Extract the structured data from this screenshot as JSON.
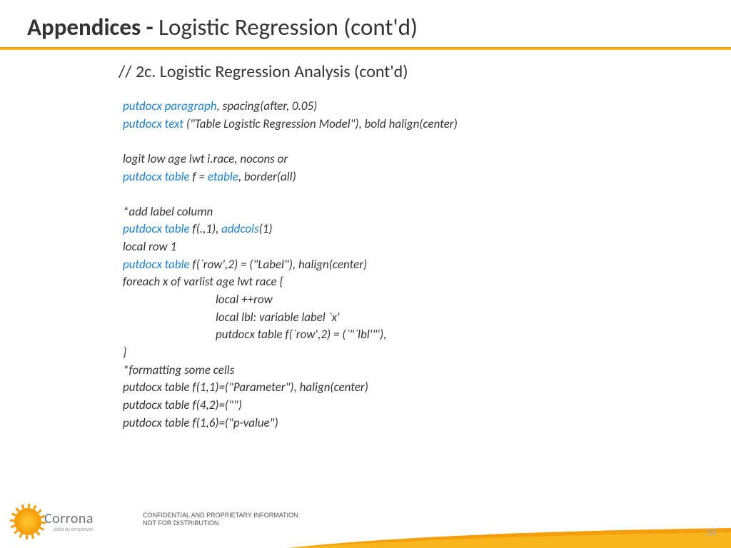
{
  "title": {
    "bold": "Appendices - ",
    "rest": "Logistic Regression (cont'd)"
  },
  "section_header": "// 2c. Logistic Regression Analysis (cont'd)",
  "code": {
    "l1_kw": "putdocx paragraph",
    "l1_rest": ", spacing(after, 0.05)",
    "l2_kw": "putdocx text ",
    "l2_rest": "(\"Table Logistic Regression Model\"), bold halign(center)",
    "l3": "logit low age lwt i.race, nocons or",
    "l4_kw1": "putdocx table ",
    "l4_mid": "f = ",
    "l4_kw2": "etable",
    "l4_rest": ", border(all)",
    "l5": "*add label column",
    "l6_kw1": "putdocx table ",
    "l6_mid": "f(.,1), ",
    "l6_kw2": "addcols",
    "l6_rest": "(1)",
    "l7": "local row 1",
    "l8_kw": "putdocx table ",
    "l8_rest": "f(`row',2) = (\"Label\"), halign(center)",
    "l9": "foreach x of varlist age lwt race {",
    "l10": "local ++row",
    "l11": "local lbl: variable label `x'",
    "l12": "putdocx table f(`row',2) = (`\"`lbl'\"'),",
    "l13": "}",
    "l14": "*formatting some cells",
    "l15": "putdocx table f(1,1)=(\"Parameter\"), halign(center)",
    "l16": "putdocx table f(4,2)=(\"\")",
    "l17": "putdocx table f(1,6)=(\"p-value\")"
  },
  "footer": {
    "logo_main": "Corrona",
    "logo_tagline": "data to empower",
    "confidential_l1": "CONFIDENTIAL AND PROPRIETARY INFORMATION",
    "confidential_l2": "NOT FOR DISTRIBUTION",
    "page_number": "34"
  }
}
